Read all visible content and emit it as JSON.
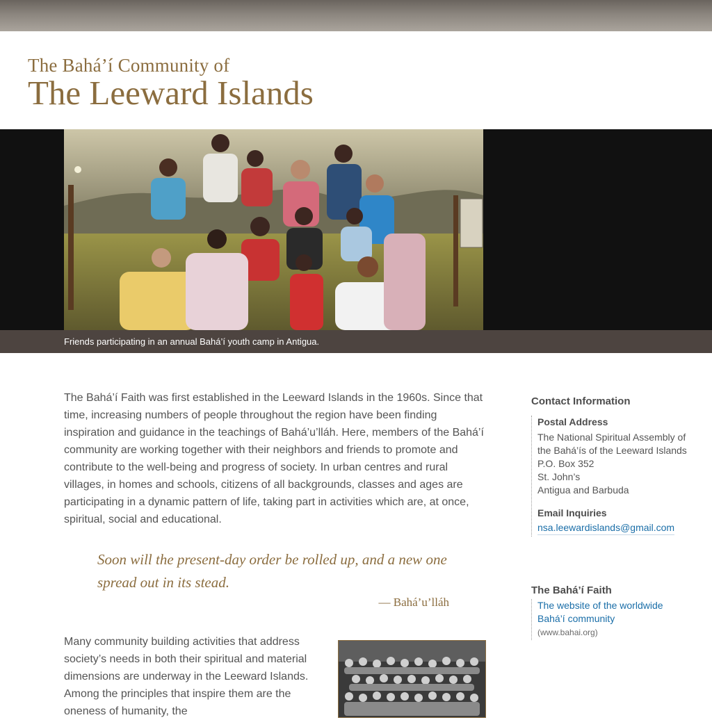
{
  "header": {
    "title_line1": "The Bahá’í Community of",
    "title_line2": "The Leeward Islands"
  },
  "hero": {
    "caption": "Friends participating in an annual Bahá’í youth camp in Antigua."
  },
  "intro": {
    "paragraph": "The Bahá’í Faith was first established in the Leeward Islands in the 1960s. Since that time, increasing numbers of people throughout the region have been finding inspiration and guidance in the teachings of Bahá’u’lláh. Here, members of the Bahá’í community are working together with their neighbors and friends to promote and contribute to the well-being and progress of society. In urban centres and rural villages, in homes and schools, citizens of all backgrounds, classes and ages are participating in a dynamic pattern of life, taking part in activities which are, at once, spiritual, social and educational."
  },
  "quote": {
    "text": "Soon will the present-day order be rolled up, and a new one spread out in its stead.",
    "author": "— Bahá’u’lláh"
  },
  "second": {
    "paragraph": "Many community building activities that address society’s needs in both their spiritual and material dimensions are underway in the Leeward Islands. Among the principles that inspire them are the oneness of humanity, the"
  },
  "sidebar": {
    "contact_heading": "Contact Information",
    "postal_heading": "Postal Address",
    "postal_lines": [
      "The National Spiritual Assembly of",
      "the Bahá’ís of the Leeward Islands",
      "P.O. Box 352",
      "St. John’s",
      "Antigua and Barbuda"
    ],
    "email_heading": "Email Inquiries",
    "email": "nsa.leewardislands@gmail.com",
    "faith_heading": "The Bahá’í Faith",
    "faith_link_line1": "The website of the worldwide",
    "faith_link_line2": "Bahá’í community",
    "faith_url": "(www.bahai.org)"
  },
  "colors": {
    "brand_gold": "#8b6d3f",
    "caption_bar": "#4d4440",
    "link_blue": "#1a6ea8"
  }
}
